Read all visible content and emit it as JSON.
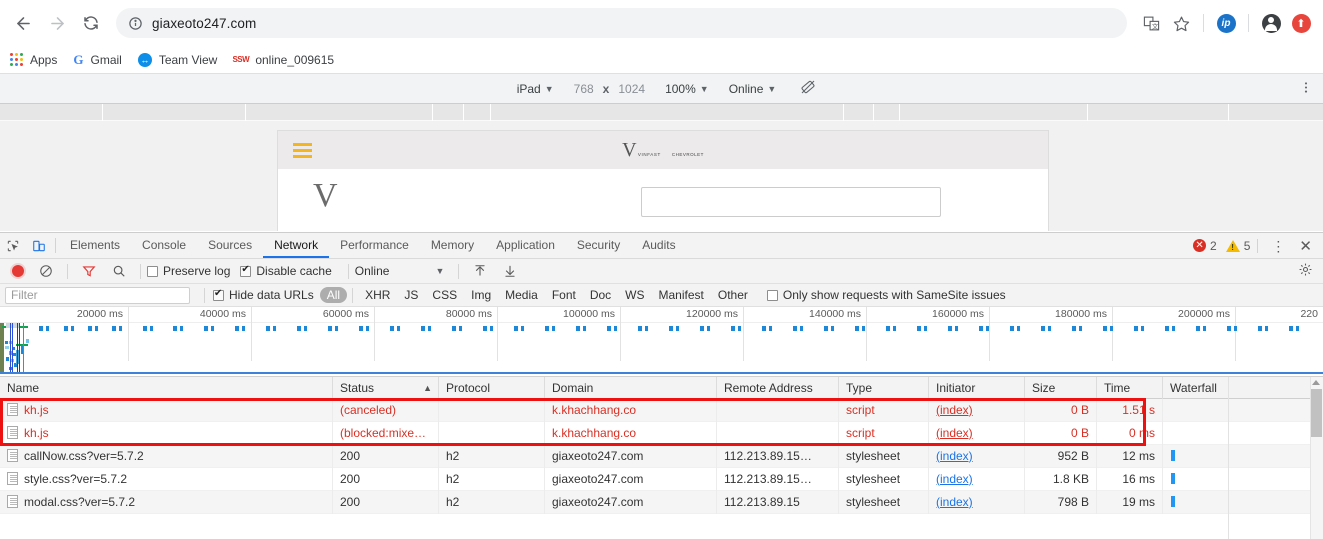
{
  "browser": {
    "url": "giaxeoto247.com",
    "nav": {
      "back": "back-arrow",
      "forward": "forward-arrow",
      "reload": "reload"
    },
    "bookmarks": [
      {
        "label": "Apps",
        "icon": "apps-grid-icon"
      },
      {
        "label": "Gmail",
        "icon": "google-g-icon"
      },
      {
        "label": "Team View",
        "icon": "teamviewer-icon"
      },
      {
        "label": "online_009615",
        "icon": "ssw-icon"
      }
    ],
    "toolbar_icons": [
      "translate-icon",
      "bookmark-star-icon",
      "ip-extension-icon",
      "profile-avatar-icon",
      "update-icon"
    ]
  },
  "device_bar": {
    "device": "iPad",
    "width": "768",
    "x": "x",
    "height": "1024",
    "zoom": "100%",
    "throttling": "Online",
    "rotate_icon": "rotate-icon",
    "menu_icon": "more-vertical-icon"
  },
  "page_preview": {
    "brand_1": "VINFAST",
    "brand_1_mark": "V",
    "brand_2": "CHEVROLET",
    "menu_icon": "hamburger-menu-icon"
  },
  "devtools": {
    "tabs": [
      {
        "label": "Elements",
        "active": false
      },
      {
        "label": "Console",
        "active": false
      },
      {
        "label": "Sources",
        "active": false
      },
      {
        "label": "Network",
        "active": true
      },
      {
        "label": "Performance",
        "active": false
      },
      {
        "label": "Memory",
        "active": false
      },
      {
        "label": "Application",
        "active": false
      },
      {
        "label": "Security",
        "active": false
      },
      {
        "label": "Audits",
        "active": false
      }
    ],
    "inspect_icon": "inspect-element-icon",
    "device_toggle_icon": "device-toolbar-icon",
    "errors": "2",
    "warnings": "5",
    "more_icon": "more-vertical-icon",
    "close_icon": "close-icon"
  },
  "network_toolbar": {
    "record_icon": "record-button",
    "clear_icon": "clear-icon",
    "filter_icon": "filter-icon",
    "search_icon": "search-icon",
    "preserve_log": "Preserve log",
    "preserve_log_checked": false,
    "disable_cache": "Disable cache",
    "disable_cache_checked": true,
    "throttling": "Online",
    "import_icon": "import-har-icon",
    "export_icon": "export-har-icon",
    "settings_icon": "gear-icon"
  },
  "filter_bar": {
    "filter_placeholder": "Filter",
    "hide_data_urls": "Hide data URLs",
    "hide_data_urls_checked": true,
    "types": [
      "All",
      "XHR",
      "JS",
      "CSS",
      "Img",
      "Media",
      "Font",
      "Doc",
      "WS",
      "Manifest",
      "Other"
    ],
    "selected_type": "All",
    "samesite_label": "Only show requests with SameSite issues",
    "samesite_checked": false
  },
  "overview": {
    "ticks": [
      "20000 ms",
      "40000 ms",
      "60000 ms",
      "80000 ms",
      "100000 ms",
      "120000 ms",
      "140000 ms",
      "160000 ms",
      "180000 ms",
      "200000 ms",
      "220"
    ]
  },
  "table": {
    "columns": [
      "Name",
      "Status",
      "Protocol",
      "Domain",
      "Remote Address",
      "Type",
      "Initiator",
      "Size",
      "Time",
      "Waterfall"
    ],
    "sorted_column": "Status",
    "sort_direction": "▲",
    "rows": [
      {
        "name": "kh.js",
        "status": "(canceled)",
        "protocol": "",
        "domain": "k.khachhang.co",
        "remote": "",
        "type": "script",
        "initiator": "(index)",
        "size": "0 B",
        "time": "1.51 s",
        "error": true,
        "waterfall": false
      },
      {
        "name": "kh.js",
        "status": "(blocked:mixe…",
        "protocol": "",
        "domain": "k.khachhang.co",
        "remote": "",
        "type": "script",
        "initiator": "(index)",
        "size": "0 B",
        "time": "0 ms",
        "error": true,
        "waterfall": false
      },
      {
        "name": "callNow.css?ver=5.7.2",
        "status": "200",
        "protocol": "h2",
        "domain": "giaxeoto247.com",
        "remote": "112.213.89.15…",
        "type": "stylesheet",
        "initiator": "(index)",
        "size": "952 B",
        "time": "12 ms",
        "error": false,
        "waterfall": true
      },
      {
        "name": "style.css?ver=5.7.2",
        "status": "200",
        "protocol": "h2",
        "domain": "giaxeoto247.com",
        "remote": "112.213.89.15…",
        "type": "stylesheet",
        "initiator": "(index)",
        "size": "1.8 KB",
        "time": "16 ms",
        "error": false,
        "waterfall": true
      },
      {
        "name": "modal.css?ver=5.7.2",
        "status": "200",
        "protocol": "h2",
        "domain": "giaxeoto247.com",
        "remote": "112.213.89.15",
        "type": "stylesheet",
        "initiator": "(index)",
        "size": "798 B",
        "time": "19 ms",
        "error": false,
        "waterfall": true
      }
    ]
  }
}
